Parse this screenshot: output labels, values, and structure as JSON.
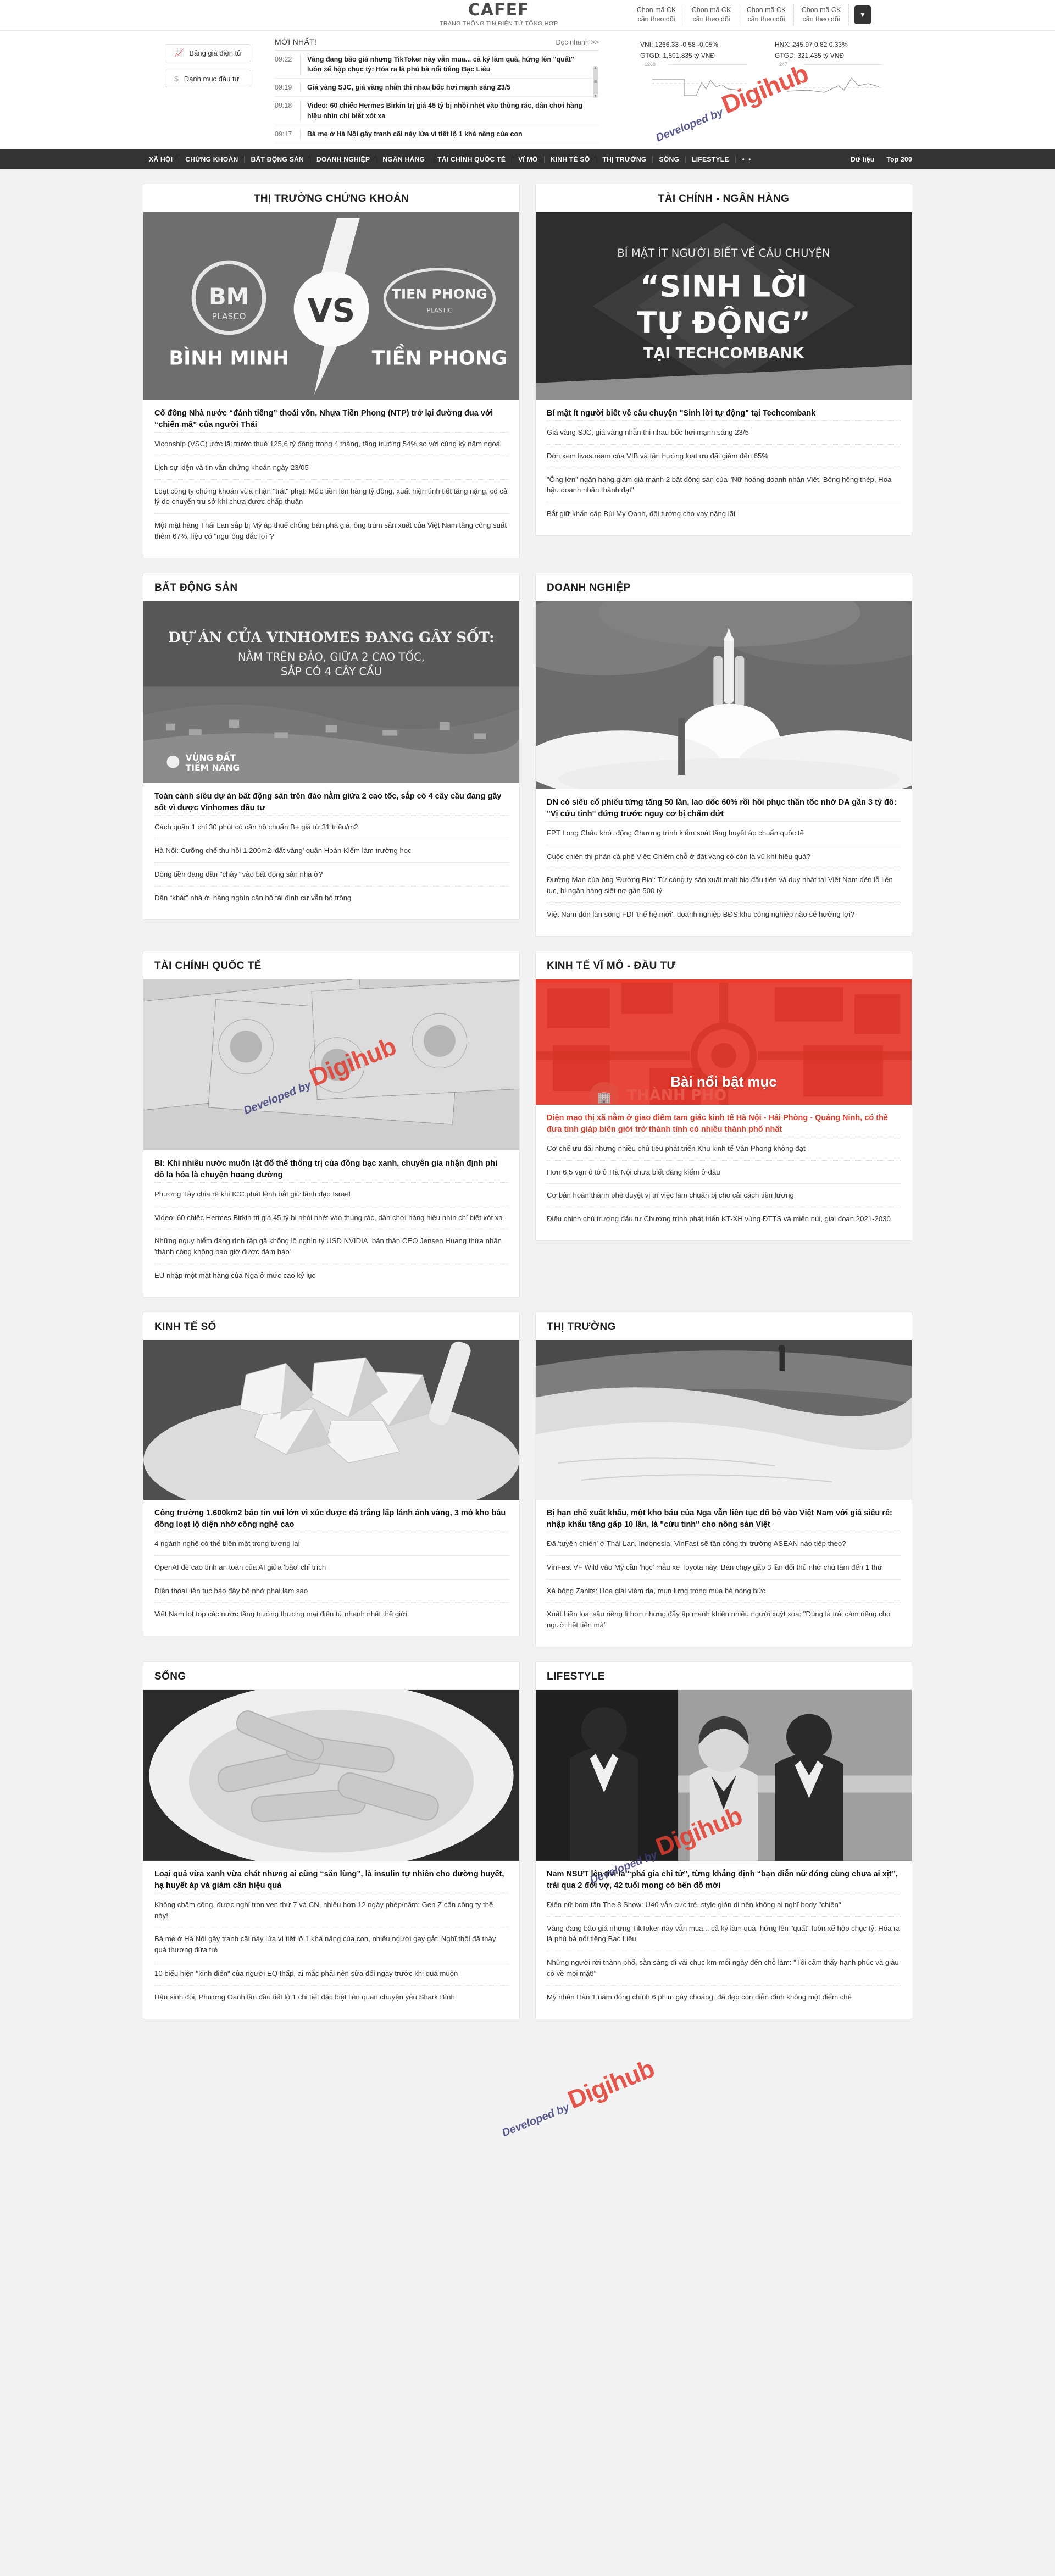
{
  "site": {
    "logo_text": "CAFEF",
    "logo_tagline": "TRANG THÔNG TIN ĐIỆN TỬ TỔNG HỢP"
  },
  "stock_picker": {
    "cells": [
      "Chọn mã CK cần theo dõi",
      "Chọn mã CK cần theo dõi",
      "Chọn mã CK cần theo dõi",
      "Chọn mã CK cần theo dõi"
    ],
    "toggle_icon": "chevron-down-icon"
  },
  "quick_links": [
    {
      "icon": "chart-icon",
      "label": "Bảng giá điện tử"
    },
    {
      "icon": "dollar-icon",
      "label": "Danh mục đầu tư"
    }
  ],
  "newest": {
    "title": "MỚI NHẤT!",
    "more": "Đọc nhanh >>",
    "rows": [
      {
        "time": "09:22",
        "text": "Vàng đang bão giá nhưng TikToker này vẫn mua... cả ký làm quà, hứng lên \"quất\" luôn xế hộp chục tỷ: Hóa ra là phú bà nổi tiếng Bạc Liêu"
      },
      {
        "time": "09:19",
        "text": "Giá vàng SJC, giá vàng nhẫn thi nhau bốc hơi mạnh sáng 23/5"
      },
      {
        "time": "09:18",
        "text": "Video: 60 chiếc Hermes Birkin trị giá 45 tỷ bị nhồi nhét vào thùng rác, dân chơi hàng hiệu nhìn chỉ biết xót xa"
      },
      {
        "time": "09:17",
        "text": "Bà mẹ ở Hà Nội gây tranh cãi nảy lửa vì tiết lộ 1 khả năng của con"
      }
    ]
  },
  "indices": [
    {
      "name": "VNI",
      "value": "1266.33",
      "change": "-0.58",
      "percent": "-0.05%",
      "line": "VNI: 1266.33 -0.58 -0.05%",
      "turnover": "GTGD: 1,801.835 tỷ VNĐ",
      "scale": "1268"
    },
    {
      "name": "HNX",
      "value": "245.97",
      "change": "0.82",
      "percent": "0.33%",
      "line": "HNX: 245.97 0.82 0.33%",
      "turnover": "GTGD: 321.435 tỷ VNĐ",
      "scale": "247"
    }
  ],
  "nav": {
    "items": [
      "XÃ HỘI",
      "CHỨNG KHOÁN",
      "BẤT ĐỘNG SẢN",
      "DOANH NGHIỆP",
      "NGÂN HÀNG",
      "TÀI CHÍNH QUỐC TẾ",
      "VĨ MÔ",
      "KINH TẾ SỐ",
      "THỊ TRƯỜNG",
      "SỐNG",
      "LIFESTYLE"
    ],
    "overflow": "• •",
    "right": [
      "Dữ liệu",
      "Top 200"
    ]
  },
  "sections": [
    {
      "key": "chung-khoan",
      "title": "THỊ TRƯỜNG CHỨNG KHOÁN",
      "title_align": "center",
      "image_caption": "BÌNH MINH VS TIỀN PHONG",
      "lead": "Cổ đông Nhà nước “đánh tiếng” thoái vốn, Nhựa Tiền Phong (NTP) trở lại đường đua với “chiến mã” của người Thái",
      "items": [
        "Viconship (VSC) ước lãi trước thuế 125,6 tỷ đồng trong 4 tháng, tăng trưởng 54% so với cùng kỳ năm ngoái",
        "Lịch sự kiện và tin vắn chứng khoán ngày 23/05",
        "Loạt công ty chứng khoán vừa nhận \"trát\" phạt: Mức tiền lên hàng tỷ đồng, xuất hiện tình tiết tăng nặng, có cả lý do chuyển trụ sở khi chưa được chấp thuận",
        "Một mặt hàng Thái Lan sắp bị Mỹ áp thuế chống bán phá giá, ông trùm sản xuất của Việt Nam tăng công suất thêm 67%, liệu có \"ngư ông đắc lợi\"?"
      ]
    },
    {
      "key": "tai-chinh-ngan-hang",
      "title": "TÀI CHÍNH - NGÂN HÀNG",
      "title_align": "center",
      "image_caption": "BÍ MẬT ÍT NGƯỜI BIẾT VỀ CÂU CHUYỆN “SINH LỜI TỰ ĐỘNG” TẠI TECHCOMBANK",
      "lead": "Bí mật ít người biết về câu chuyện \"Sinh lời tự động\" tại Techcombank",
      "items": [
        "Giá vàng SJC, giá vàng nhẫn thi nhau bốc hơi mạnh sáng 23/5",
        "Đón xem livestream của VIB và tận hưởng loạt ưu đãi giảm đến 65%",
        "\"Ông lớn\" ngân hàng giảm giá mạnh 2 bất động sản của \"Nữ hoàng doanh nhân Việt, Bông hồng thép, Hoa hậu doanh nhân thành đạt\"",
        "Bắt giữ khẩn cấp Bùi My Oanh, đối tượng cho vay nặng lãi"
      ]
    },
    {
      "key": "bat-dong-san",
      "title": "BẤT ĐỘNG SẢN",
      "title_align": "left",
      "image_caption": "DỰ ÁN CỦA VINHOMES ĐANG GÂY SỐT: NẰM TRÊN ĐẢO, GIỮA 2 CAO TỐC, SẮP CÓ 4 CÂY CẦU",
      "lead": "Toàn cảnh siêu dự án bất động sản trên đảo nằm giữa 2 cao tốc, sắp có 4 cây cầu đang gây sốt vì được Vinhomes đầu tư",
      "items": [
        "Cách quận 1 chỉ 30 phút có căn hộ chuẩn B+ giá từ 31 triệu/m2",
        "Hà Nội: Cưỡng chế thu hồi 1.200m2 ‘đất vàng’ quận Hoàn Kiếm làm trường học",
        "Dòng tiền đang dần \"chảy\" vào bất động sản nhà ở?",
        "Dân “khát” nhà ở, hàng nghìn căn hộ tái định cư vẫn bỏ trống"
      ]
    },
    {
      "key": "doanh-nghiep",
      "title": "DOANH NGHIỆP",
      "title_align": "left",
      "image_caption": "",
      "lead": "DN có siêu cổ phiếu từng tăng 50 lần, lao dốc 60% rồi hồi phục thần tốc nhờ DA gần 3 tỷ đô: \"Vị cứu tinh\" đứng trước nguy cơ bị chấm dứt",
      "items": [
        "FPT Long Châu khởi động Chương trình kiểm soát tăng huyết áp chuẩn quốc tế",
        "Cuộc chiến thị phần cà phê Việt: Chiếm chỗ ở đất vàng có còn là vũ khí hiệu quả?",
        "Đường Man của ông 'Đường Bia': Từ công ty sản xuất malt bia đầu tiên và duy nhất tại Việt Nam đến lỗ liên tục, bị ngân hàng siết nợ gần 500 tỷ",
        "Việt Nam đón làn sóng FDI 'thế hệ mới', doanh nghiệp BĐS khu công nghiệp nào sẽ hưởng lợi?"
      ]
    },
    {
      "key": "tai-chinh-quoc-te",
      "title": "TÀI CHÍNH QUỐC TẾ",
      "title_align": "left",
      "image_caption": "",
      "lead": "BI: Khi nhiều nước muốn lật đổ thế thống trị của đồng bạc xanh, chuyên gia nhận định phi đô la hóa là chuyện hoang đường",
      "items": [
        "Phương Tây chia rẽ khi ICC phát lệnh bắt giữ lãnh đạo Israel",
        "Video: 60 chiếc Hermes Birkin trị giá 45 tỷ bị nhồi nhét vào thùng rác, dân chơi hàng hiệu nhìn chỉ biết xót xa",
        "Những nguy hiểm đang rình rập gã khổng lồ nghìn tỷ USD NVIDIA, bản thân CEO Jensen Huang thừa nhận 'thành công không bao giờ được đảm bảo'",
        "EU nhập một mặt hàng của Nga ở mức cao kỷ lục"
      ]
    },
    {
      "key": "kinh-te-vi-mo",
      "title": "KINH TẾ VĨ MÔ - ĐẦU TƯ",
      "title_align": "left",
      "image_caption": "THÀNH PHỐ TƯƠNG LAI",
      "highlight_label": "Bài nổi bật mục",
      "lead": "Diện mạo thị xã nằm ở giao điểm tam giác kinh tế Hà Nội - Hải Phòng - Quảng Ninh, có thể đưa tỉnh giáp biên giới trở thành tỉnh có nhiều thành phố nhất",
      "items": [
        "Cơ chế ưu đãi nhưng nhiều chủ tiêu phát triển Khu kinh tế Vân Phong không đạt",
        "Hơn 6,5 vạn ô tô ở Hà Nội chưa biết đăng kiểm ở đâu",
        "Cơ bản hoàn thành phê duyệt vị trí việc làm chuẩn bị cho cải cách tiền lương",
        "Điều chỉnh chủ trương đầu tư Chương trình phát triển KT-XH vùng ĐTTS và miền núi, giai đoạn 2021-2030"
      ]
    },
    {
      "key": "kinh-te-so",
      "title": "KINH TẾ SỐ",
      "title_align": "left",
      "image_caption": "",
      "lead": "Công trường 1.600km2 báo tin vui lớn vì xúc được đá trắng lấp lánh ánh vàng, 3 mỏ kho báu đồng loạt lộ diện nhờ công nghệ cao",
      "items": [
        "4 ngành nghề có thể biến mất trong tương lai",
        "OpenAI đề cao tính an toàn của AI giữa 'bão' chỉ trích",
        "Điện thoại liên tục báo đầy bộ nhớ phải làm sao",
        "Việt Nam lọt top các nước tăng trưởng thương mại điện tử nhanh nhất thế giới"
      ]
    },
    {
      "key": "thi-truong",
      "title": "THỊ TRƯỜNG",
      "title_align": "left",
      "image_caption": "",
      "lead": "Bị hạn chế xuất khẩu, một kho báu của Nga vẫn liên tục đổ bộ vào Việt Nam với giá siêu rẻ: nhập khẩu tăng gấp 10 lần, là \"cứu tinh\" cho nông sản Việt",
      "items": [
        "Đã 'tuyên chiến' ở Thái Lan, Indonesia, VinFast sẽ tấn công thị trường ASEAN nào tiếp theo?",
        "VinFast VF Wild vào Mỹ cần 'học' mẫu xe Toyota này: Bán chạy gấp 3 lần đối thủ nhờ chú tâm đến 1 thứ",
        "Xà bông Zanits: Hoa giải viêm da, mụn lưng trong mùa hè nóng bức",
        "Xuất hiện loại sầu riêng lì hơn nhưng đẩy ập mạnh khiến nhiều người xuýt xoa: \"Đúng là trái cảm riêng cho người hết tiền mà\""
      ]
    },
    {
      "key": "song",
      "title": "SỐNG",
      "title_align": "left",
      "image_caption": "",
      "lead": "Loại quả vừa xanh vừa chát nhưng ai cũng “săn lùng”, là insulin tự nhiên cho đường huyết, hạ huyết áp và giảm cân hiệu quả",
      "items": [
        "Không chấm công, được nghỉ trọn vẹn thứ 7 và CN, nhiều hơn 12 ngày phép/năm: Gen Z cần công ty thế này!",
        "Bà mẹ ở Hà Nội gây tranh cãi nảy lửa vì tiết lộ 1 khả năng của con, nhiều người gay gắt: Nghĩ thôi đã thấy quá thương đứa trẻ",
        "10 biểu hiện \"kinh điển\" của người EQ thấp, ai mắc phải nên sửa đổi ngay trước khi quá muộn",
        "Hậu sinh đôi, Phương Oanh lần đầu tiết lộ 1 chi tiết đặc biệt liên quan chuyện yêu Shark Bình"
      ]
    },
    {
      "key": "lifestyle",
      "title": "LIFESTYLE",
      "title_align": "left",
      "image_caption": "",
      "lead": "Nam NSƯT lên tivi là “phá gia chi tử”, từng khẳng định “bạn diễn nữ đóng cùng chưa ai xịt”, trải qua 2 đời vợ, 42 tuổi mong có bến đỗ mới",
      "items": [
        "Điên nữ bom tấn The 8 Show: U40 vẫn cực trẻ, style giản dị nên không ai nghĩ body \"chiến\"",
        "Vàng đang bão giá nhưng TikToker này vẫn mua... cả ký làm quà, hứng lên \"quất\" luôn xế hộp chục tỷ: Hóa ra là phú bà nổi tiếng Bạc Liêu",
        "Những người rời thành phố, sẵn sàng đi vài chục km mỗi ngày đến chỗ làm: \"Tôi cảm thấy hạnh phúc và giàu có về mọi mặt!\"",
        "Mỹ nhân Hàn 1 năm đóng chính 6 phim gây choáng, đã đẹp còn diễn đỉnh không một điểm chê"
      ]
    }
  ],
  "watermarks": [
    {
      "dev": "Developed by",
      "brand": "Digihub"
    },
    {
      "dev": "Developed by",
      "brand": "Digihub"
    },
    {
      "dev": "Developed by",
      "brand": "Digihub"
    },
    {
      "dev": "Developed by",
      "brand": "Digihub"
    }
  ],
  "colors": {
    "accent_red": "#e23b2e",
    "nav_bg": "#333333",
    "highlight": "#ef3b2c"
  }
}
